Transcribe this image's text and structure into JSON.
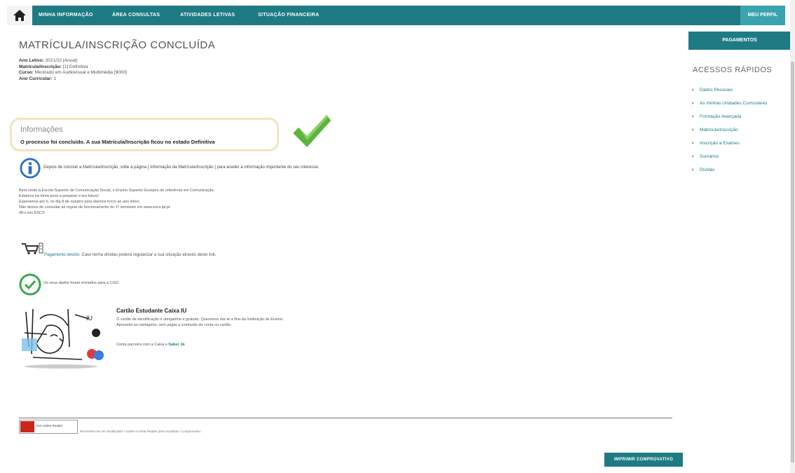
{
  "nav": {
    "items": [
      "MINHA INFORMAÇÃO",
      "ÁREA CONSULTAS",
      "ATIVIDADES LETIVAS",
      "SITUAÇÃO FINANCEIRA"
    ],
    "profile": "MEU PERFIL"
  },
  "main": {
    "title": "MATRÍCULA/INSCRIÇÃO CONCLUÍDA",
    "meta": [
      {
        "label": "Ano Letivo:",
        "value": "2021/22 [Anual]"
      },
      {
        "label": "Matrícula/Inscrição:",
        "value": "[1] Definitiva"
      },
      {
        "label": "Curso:",
        "value": "Mestrado em Audiovisual e Multimédia [9000]"
      },
      {
        "label": "Ano Curricular:",
        "value": "1"
      }
    ],
    "info_heading": "Informações",
    "info_message": "O processo foi concluído. A sua Matrícula/Inscrição ficou no estado Definitiva",
    "notice": "Depois de concluir a Matrícula/Inscrição, volte à página [ Informação da Matrícula/Inscrição ] para aceder à informação importante do seu interesse.",
    "welcome_lines": [
      "Bem-vindo à Escola Superior de Comunicação Social, o Ensino Superior Europeu de referência em Comunicação.",
      "Estamos há trinta anos a preparar o teu futuro!",
      "Esperamos por ti, no dia 8 de outubro para darmos início ao ano letivo.",
      "Não deixes de consultar as regras de funcionamento do 1º semestre em www.escs.ipl.pt",
      "#Eu sou ESCS"
    ],
    "payment_link": "Pagamento devido.",
    "payment_text": "Caso tenha dívidas poderá regularizar a sua situação através deste link.",
    "data_sent": "Os seus dados foram enviados para a CGD.",
    "card_title": "Cartão Estudante Caixa IU",
    "card_lines": [
      "O cartão de identificação é obrigatório e gratuito. Queremos dar-te a fina da Instituição de Ensino.",
      "Aproveita as vantagens, sem pagar a comissão de conta ou cartão."
    ],
    "card_link_prefix": "Conta parceira com a Caixa e",
    "card_link": "Saber Já",
    "adobe_label": "Get Adobe Reader",
    "adobe_note": "Necessário ter um visualizador / Adobe Acrobat Reader para visualizar o comprovativo",
    "print_button": "IMPRIMIR COMPROVATIVO"
  },
  "sidebar": {
    "pay_button": "PAGAMENTOS",
    "heading": "ACESSOS RÁPIDOS",
    "items": [
      "Dados Pessoais",
      "As minhas Unidades Curriculares",
      "Formação Avançada",
      "Matrícula/Inscrição",
      "Inscrição a Exames",
      "Sumários",
      "Dívidas"
    ]
  },
  "colors": {
    "accent": "#1e7b84",
    "accent_light": "#3aa3ae"
  }
}
